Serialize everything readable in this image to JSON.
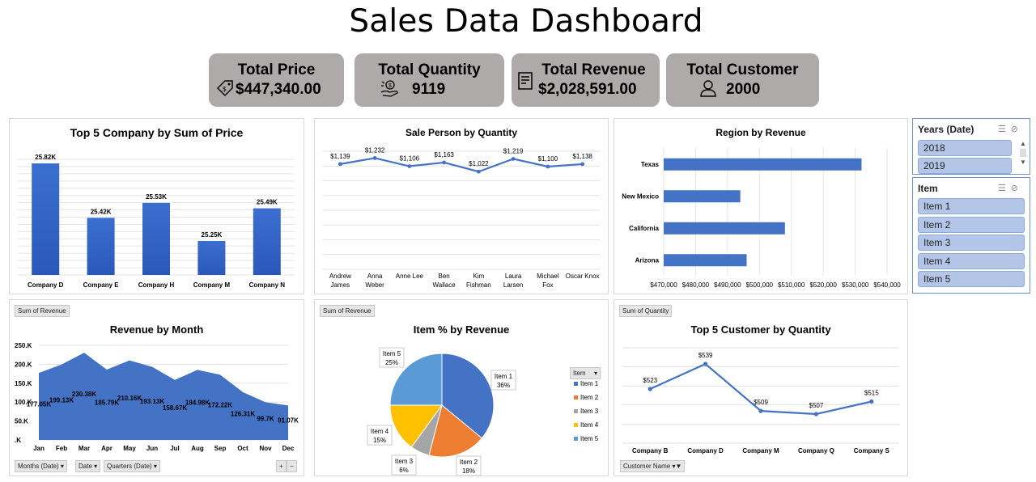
{
  "page": {
    "title": "Sales Data Dashboard"
  },
  "kpis": [
    {
      "label": "Total Price",
      "value": "$447,340.00",
      "icon": "price-tag-icon"
    },
    {
      "label": "Total Quantity",
      "value": "9119",
      "icon": "money-hand-icon"
    },
    {
      "label": "Total Revenue",
      "value": "$2,028,591.00",
      "icon": "receipt-icon"
    },
    {
      "label": "Total Customer",
      "value": "2000",
      "icon": "user-icon"
    }
  ],
  "slicers": {
    "years": {
      "title": "Years (Date)",
      "items": [
        "2018",
        "2019"
      ]
    },
    "item": {
      "title": "Item",
      "items": [
        "Item 1",
        "Item 2",
        "Item 3",
        "Item 4",
        "Item 5"
      ]
    }
  },
  "panels": {
    "revenue_by_month": {
      "field_button": "Sum of Revenue",
      "axis_buttons": [
        "Months (Date)",
        "Date",
        "Quarters (Date)"
      ],
      "plus": "+",
      "minus": "−"
    },
    "item_pct": {
      "field_button": "Sum of Revenue",
      "legend_button": "Item"
    },
    "top_customer": {
      "field_button": "Sum of Quantity",
      "axis_button": "Customer Name"
    }
  },
  "chart_data": [
    {
      "type": "bar",
      "title": "Top  5 Company by Sum of Price",
      "categories": [
        "Company D",
        "Company E",
        "Company H",
        "Company M",
        "Company N"
      ],
      "values": [
        25.82,
        25.42,
        25.53,
        25.25,
        25.49
      ],
      "labels": [
        "25.82K",
        "25.42K",
        "25.53K",
        "25.25K",
        "25.49K"
      ],
      "unit": "K",
      "ylim": [
        25.0,
        25.85
      ],
      "color": "#4472c4"
    },
    {
      "type": "line",
      "title": "Sale Person by Quantity",
      "categories": [
        "Andrew James",
        "Anna Weber",
        "Anne Lee",
        "Ben Wallace",
        "Kim Fishman",
        "Laura Larsen",
        "Michael Fox",
        "Oscar Knox"
      ],
      "values": [
        1139,
        1232,
        1106,
        1163,
        1022,
        1219,
        1100,
        1138
      ],
      "labels": [
        "$1,139",
        "$1,232",
        "$1,106",
        "$1,163",
        "$1,022",
        "$1,219",
        "$1,100",
        "$1,138"
      ],
      "color": "#4472c4"
    },
    {
      "type": "bar",
      "orientation": "horizontal",
      "title": "Region by Revenue",
      "categories": [
        "Texas",
        "New Mexico",
        "California",
        "Arizona"
      ],
      "values": [
        532000,
        494000,
        508000,
        496000
      ],
      "xlim": [
        470000,
        540000
      ],
      "xticks": [
        "$470,000",
        "$480,000",
        "$490,000",
        "$500,000",
        "$510,000",
        "$520,000",
        "$530,000",
        "$540,000"
      ],
      "color": "#4472c4"
    },
    {
      "type": "area",
      "title": "Revenue by Month",
      "categories": [
        "Jan",
        "Feb",
        "Mar",
        "Apr",
        "May",
        "Jun",
        "Jul",
        "Aug",
        "Sep",
        "Oct",
        "Nov",
        "Dec"
      ],
      "values": [
        177.05,
        199.13,
        230.38,
        185.79,
        210.16,
        193.13,
        158.67,
        184.98,
        172.22,
        126.31,
        99.7,
        91.07
      ],
      "labels": [
        "177.05K",
        "199.13K",
        "230.38K",
        "185.79K",
        "210.16K",
        "193.13K",
        "158.67K",
        "184.98K",
        "172.22K",
        "126.31K",
        "99.7K",
        "91.07K"
      ],
      "yticks": [
        "250.K",
        "200.K",
        "150.K",
        "100.K",
        "50.K",
        ".K"
      ],
      "ylim": [
        0,
        250
      ],
      "color": "#4472c4"
    },
    {
      "type": "pie",
      "title": "Item % by Revenue",
      "categories": [
        "Item 1",
        "Item 2",
        "Item 3",
        "Item 4",
        "Item 5"
      ],
      "values": [
        36,
        18,
        6,
        15,
        25
      ],
      "labels": [
        "36%",
        "18%",
        "6%",
        "15%",
        "25%"
      ],
      "colors": [
        "#4472c4",
        "#ed7d31",
        "#a5a5a5",
        "#ffc000",
        "#5b9bd5"
      ]
    },
    {
      "type": "line",
      "title": "Top 5 Customer by Quantity",
      "categories": [
        "Company B",
        "Company D",
        "Company M",
        "Company Q",
        "Company S"
      ],
      "values": [
        523,
        539,
        509,
        507,
        515
      ],
      "labels": [
        "$523",
        "$539",
        "$509",
        "$507",
        "$515"
      ],
      "color": "#4472c4"
    }
  ]
}
